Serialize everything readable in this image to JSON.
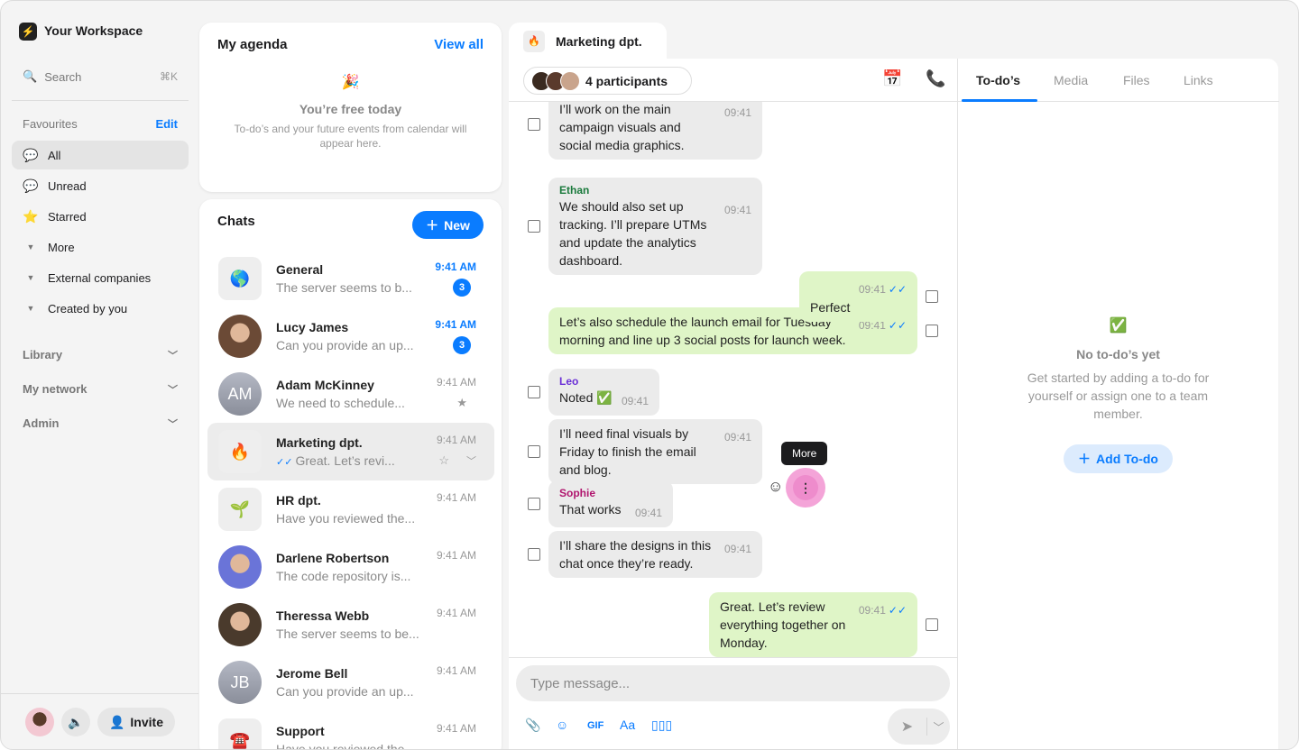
{
  "sidebar": {
    "workspace": "Your Workspace",
    "search": "Search",
    "search_shortcut": "⌘K",
    "favourites": "Favourites",
    "edit": "Edit",
    "items": [
      {
        "label": "All",
        "icon": "💬"
      },
      {
        "label": "Unread",
        "icon": "💬"
      },
      {
        "label": "Starred",
        "icon": "⭐"
      },
      {
        "label": "More"
      },
      {
        "label": "External companies"
      },
      {
        "label": "Created by you"
      }
    ],
    "sections": [
      "Library",
      "My network",
      "Admin"
    ],
    "invite": "Invite"
  },
  "agenda": {
    "title": "My agenda",
    "view_all": "View all",
    "icon": "🎉",
    "free": "You’re free today",
    "desc": "To-do’s and your future events from calendar will appear here."
  },
  "chats": {
    "title": "Chats",
    "new": "New",
    "list": [
      {
        "name": "General",
        "preview": "The server seems to b...",
        "time": "9:41 AM",
        "unread": 3,
        "avatar": "🌎",
        "type": "emoji"
      },
      {
        "name": "Lucy James",
        "preview": "Can you provide an up...",
        "time": "9:41 AM",
        "unread": 3,
        "type": "photo",
        "color": "#6b4a36"
      },
      {
        "name": "Adam McKinney",
        "preview": "We need to schedule...",
        "time": "9:41 AM",
        "initials": "AM",
        "starred": true,
        "type": "initials"
      },
      {
        "name": "Marketing dpt.",
        "preview": "Great. Let’s revi...",
        "time": "9:41 AM",
        "avatar": "🔥",
        "type": "emoji",
        "active": true,
        "read": true
      },
      {
        "name": "HR dpt.",
        "preview": "Have you reviewed the...",
        "time": "9:41 AM",
        "avatar": "🌱",
        "type": "emoji"
      },
      {
        "name": "Darlene Robertson",
        "preview": "The code repository is...",
        "time": "9:41 AM",
        "type": "photo",
        "color": "#6a74d8"
      },
      {
        "name": "Theressa Webb",
        "preview": "The server seems to be...",
        "time": "9:41 AM",
        "type": "photo",
        "color": "#4a3a2c"
      },
      {
        "name": "Jerome Bell",
        "preview": "Can you provide an up...",
        "time": "9:41 AM",
        "initials": "JB",
        "type": "initials"
      },
      {
        "name": "Support",
        "preview": "Have you reviewed the...",
        "time": "9:41 AM",
        "avatar": "☎️",
        "type": "emoji"
      }
    ]
  },
  "conversation": {
    "tab": "Marketing dpt.",
    "tab_icon": "🔥",
    "participants": "4 participants",
    "messages": [
      {
        "dir": "in",
        "sender": "",
        "text": "I’ll work on the main campaign visuals and social media graphics.",
        "time": "09:41"
      },
      {
        "dir": "in",
        "sender": "Ethan",
        "sender_color": "#1a7a3c",
        "text": "We should also set up tracking. I’ll prepare UTMs and update the analytics dashboard.",
        "time": "09:41"
      },
      {
        "dir": "out",
        "text": "Perfect",
        "time": "09:41"
      },
      {
        "dir": "out",
        "text": "Let’s also schedule the launch email for Tuesday morning and line up 3 social posts for launch week.",
        "time": "09:41"
      },
      {
        "dir": "in",
        "sender": "Leo",
        "sender_color": "#6a2fd6",
        "text": "Noted ✅",
        "time": "09:41"
      },
      {
        "dir": "in",
        "sender": "",
        "text": "I’ll need final visuals by Friday to finish the email and blog.",
        "time": "09:41"
      },
      {
        "dir": "in",
        "sender": "Sophie",
        "sender_color": "#b0156e",
        "text": "That works",
        "time": "09:41"
      },
      {
        "dir": "in",
        "sender": "",
        "text": "I’ll share the designs in this chat once they’re ready.",
        "time": "09:41"
      },
      {
        "dir": "out",
        "text": "Great. Let’s review everything together on Monday.",
        "time": "09:41"
      }
    ],
    "tooltip": "More",
    "placeholder": "Type message...",
    "gif": "GIF",
    "format": "Aa"
  },
  "panel": {
    "tabs": [
      "To-do’s",
      "Media",
      "Files",
      "Links"
    ],
    "empty_icon": "✅",
    "empty_title": "No to-do’s yet",
    "empty_desc": "Get started by adding a to-do for yourself or assign one to a team member.",
    "add": "Add To-do"
  }
}
